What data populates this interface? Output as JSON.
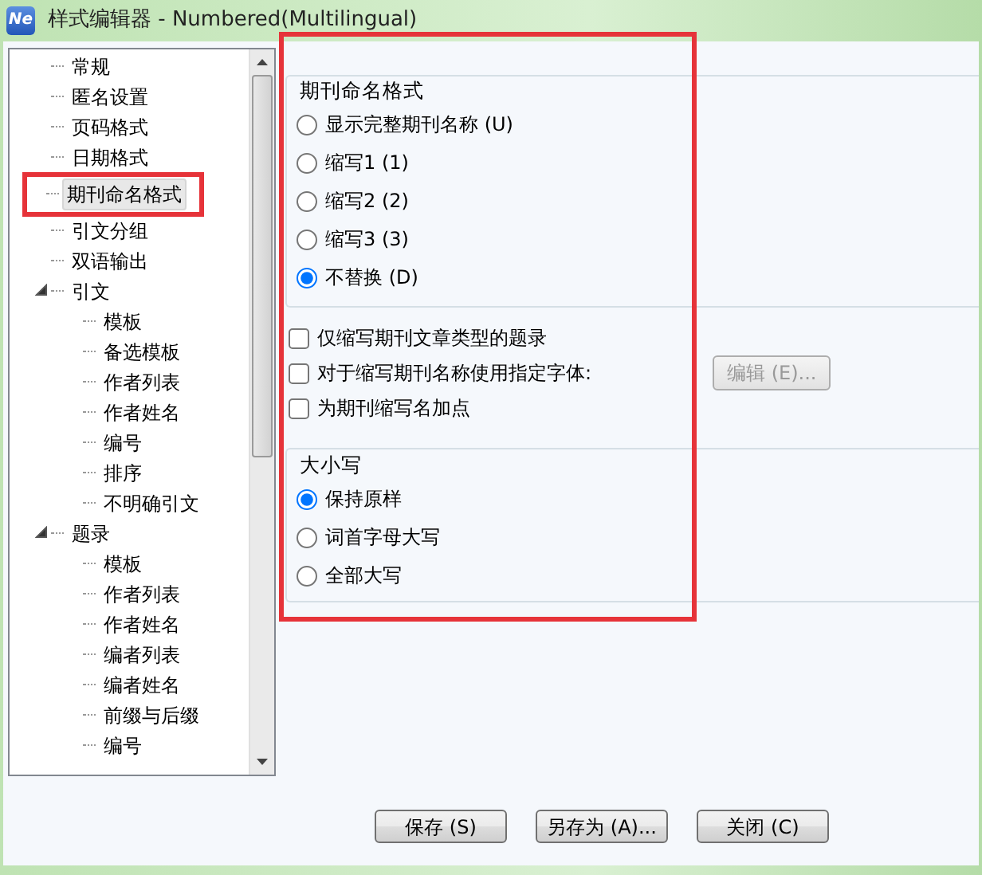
{
  "window": {
    "icon_label": "Ne",
    "title": "样式编辑器 - Numbered(Multilingual)"
  },
  "sidebar": {
    "items": [
      {
        "label": "常规",
        "selected": false,
        "highlighted": false
      },
      {
        "label": "匿名设置",
        "selected": false,
        "highlighted": false
      },
      {
        "label": "页码格式",
        "selected": false,
        "highlighted": false
      },
      {
        "label": "日期格式",
        "selected": false,
        "highlighted": false
      },
      {
        "label": "期刊命名格式",
        "selected": true,
        "highlighted": true
      },
      {
        "label": "引文分组",
        "selected": false,
        "highlighted": false
      },
      {
        "label": "双语输出",
        "selected": false,
        "highlighted": false
      },
      {
        "label": "引文",
        "selected": false,
        "highlighted": false,
        "expanded": true,
        "children": [
          {
            "label": "模板",
            "selected": false,
            "highlighted": false
          },
          {
            "label": "备选模板",
            "selected": false,
            "highlighted": false
          },
          {
            "label": "作者列表",
            "selected": false,
            "highlighted": false
          },
          {
            "label": "作者姓名",
            "selected": false,
            "highlighted": false
          },
          {
            "label": "编号",
            "selected": false,
            "highlighted": false
          },
          {
            "label": "排序",
            "selected": false,
            "highlighted": false
          },
          {
            "label": "不明确引文",
            "selected": false,
            "highlighted": false
          }
        ]
      },
      {
        "label": "题录",
        "selected": false,
        "highlighted": false,
        "expanded": true,
        "children": [
          {
            "label": "模板",
            "selected": false,
            "highlighted": false
          },
          {
            "label": "作者列表",
            "selected": false,
            "highlighted": false
          },
          {
            "label": "作者姓名",
            "selected": false,
            "highlighted": false
          },
          {
            "label": "编者列表",
            "selected": false,
            "highlighted": false
          },
          {
            "label": "编者姓名",
            "selected": false,
            "highlighted": false
          },
          {
            "label": "前缀与后缀",
            "selected": false,
            "highlighted": false
          },
          {
            "label": "编号",
            "selected": false,
            "highlighted": false
          }
        ]
      }
    ]
  },
  "panel": {
    "highlighted": true,
    "naming_group": {
      "title": "期刊命名格式",
      "options": [
        {
          "label": "显示完整期刊名称 (U)",
          "selected": false
        },
        {
          "label": "缩写1 (1)",
          "selected": false
        },
        {
          "label": "缩写2 (2)",
          "selected": false
        },
        {
          "label": "缩写3 (3)",
          "selected": false
        },
        {
          "label": "不替换 (D)",
          "selected": true
        }
      ]
    },
    "checkboxes": [
      {
        "label": "仅缩写期刊文章类型的题录",
        "checked": false
      },
      {
        "label": "对于缩写期刊名称使用指定字体:",
        "checked": false,
        "button": {
          "label": "编辑 (E)...",
          "disabled": true
        }
      },
      {
        "label": "为期刊缩写名加点",
        "checked": false
      }
    ],
    "case_group": {
      "title": "大小写",
      "options": [
        {
          "label": "保持原样",
          "selected": true
        },
        {
          "label": "词首字母大写",
          "selected": false
        },
        {
          "label": "全部大写",
          "selected": false
        }
      ]
    }
  },
  "buttons": [
    {
      "label": "保存 (S)"
    },
    {
      "label": "另存为 (A)..."
    },
    {
      "label": "关闭 (C)"
    }
  ]
}
